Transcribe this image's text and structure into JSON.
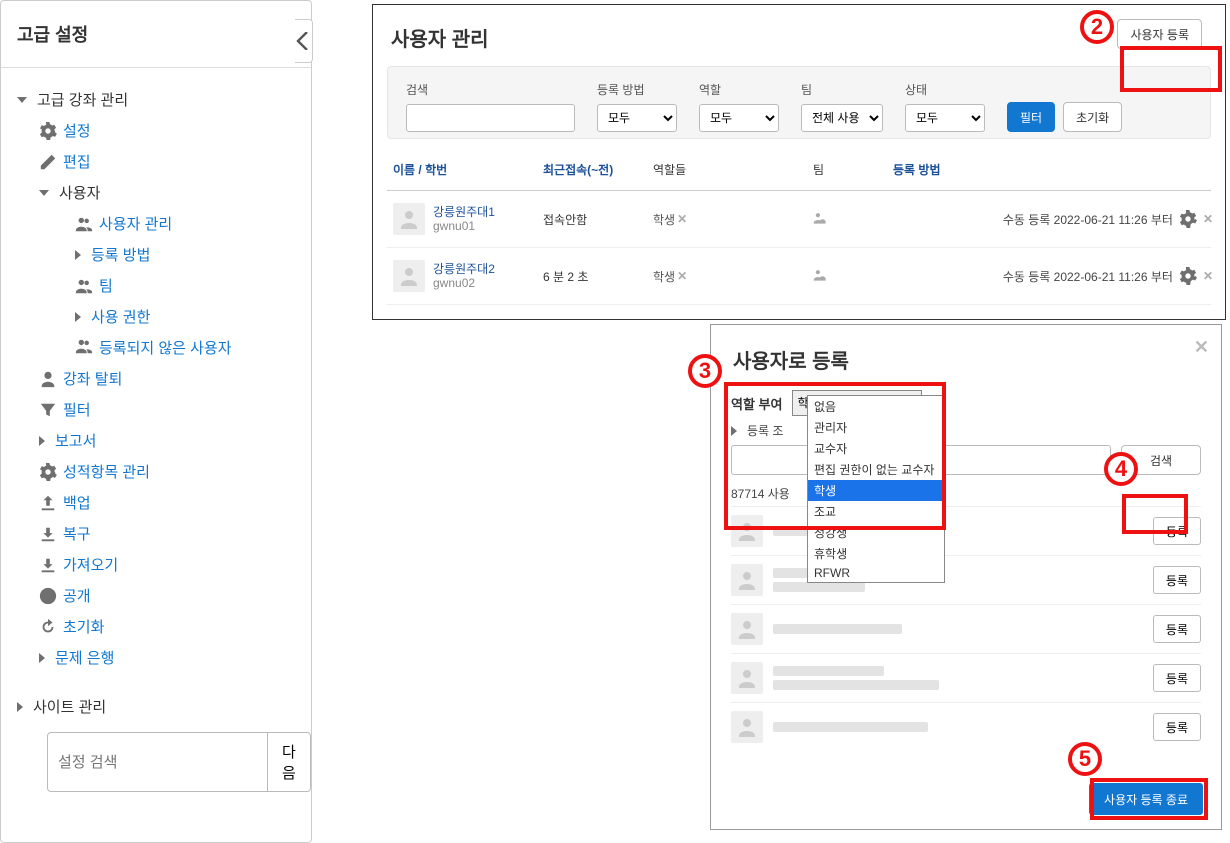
{
  "sidebar": {
    "header": "고급 설정",
    "root_label": "고급 강좌 관리",
    "items": [
      {
        "icon": "gear",
        "label": "설정"
      },
      {
        "icon": "pencil",
        "label": "편집"
      },
      {
        "icon": "caret-down",
        "label": "사용자",
        "children": [
          {
            "icon": "users",
            "label": "사용자 관리"
          },
          {
            "icon": "tri",
            "label": "등록 방법"
          },
          {
            "icon": "users",
            "label": "팀"
          },
          {
            "icon": "tri",
            "label": "사용 권한"
          },
          {
            "icon": "users",
            "label": "등록되지 않은 사용자"
          }
        ]
      },
      {
        "icon": "user",
        "label": "강좌 탈퇴"
      },
      {
        "icon": "filter",
        "label": "필터"
      },
      {
        "icon": "tri",
        "label": "보고서"
      },
      {
        "icon": "gear",
        "label": "성적항목 관리"
      },
      {
        "icon": "upload",
        "label": "백업"
      },
      {
        "icon": "download",
        "label": "복구"
      },
      {
        "icon": "download",
        "label": "가져오기"
      },
      {
        "icon": "globe",
        "label": "공개"
      },
      {
        "icon": "refresh",
        "label": "초기화"
      },
      {
        "icon": "tri",
        "label": "문제 은행"
      }
    ],
    "site_label": "사이트 관리",
    "search_placeholder": "설정 검색",
    "search_button": "다음"
  },
  "main": {
    "title": "사용자 관리",
    "enroll_button": "사용자 등록",
    "filters": {
      "search_label": "검색",
      "enroll_method_label": "등록 방법",
      "enroll_method_value": "모두",
      "role_label": "역할",
      "role_value": "모두",
      "team_label": "팀",
      "team_value": "전체 사용",
      "status_label": "상태",
      "status_value": "모두",
      "filter_btn": "필터",
      "reset_btn": "초기화"
    },
    "columns": {
      "name": "이름 / 학번",
      "lastaccess": "최근접속(~전)",
      "roles": "역할들",
      "team": "팀",
      "method": "등록 방법"
    },
    "rows": [
      {
        "name": "강릉원주대1",
        "uid": "gwnu01",
        "lastaccess": "접속안함",
        "role": "학생",
        "method": "수동 등록 2022-06-21 11:26 부터"
      },
      {
        "name": "강릉원주대2",
        "uid": "gwnu02",
        "lastaccess": "6 분 2 초",
        "role": "학생",
        "method": "수동 등록 2022-06-21 11:26 부터"
      }
    ]
  },
  "modal": {
    "title": "사용자로 등록",
    "role_label": "역할 부여",
    "role_selected": "학생",
    "role_options": [
      "없음",
      "관리자",
      "교수자",
      "편집 권한이 없는 교수자",
      "학생",
      "조교",
      "청강생",
      "휴학생",
      "RFWR"
    ],
    "enroll_cond_label": "등록 조",
    "search_button": "검색",
    "count_prefix": "87714 사용",
    "row_enroll_btn": "등록",
    "done_button": "사용자 등록 종료"
  },
  "annotations": {
    "a2": "2",
    "a3": "3",
    "a4": "4",
    "a5": "5"
  }
}
